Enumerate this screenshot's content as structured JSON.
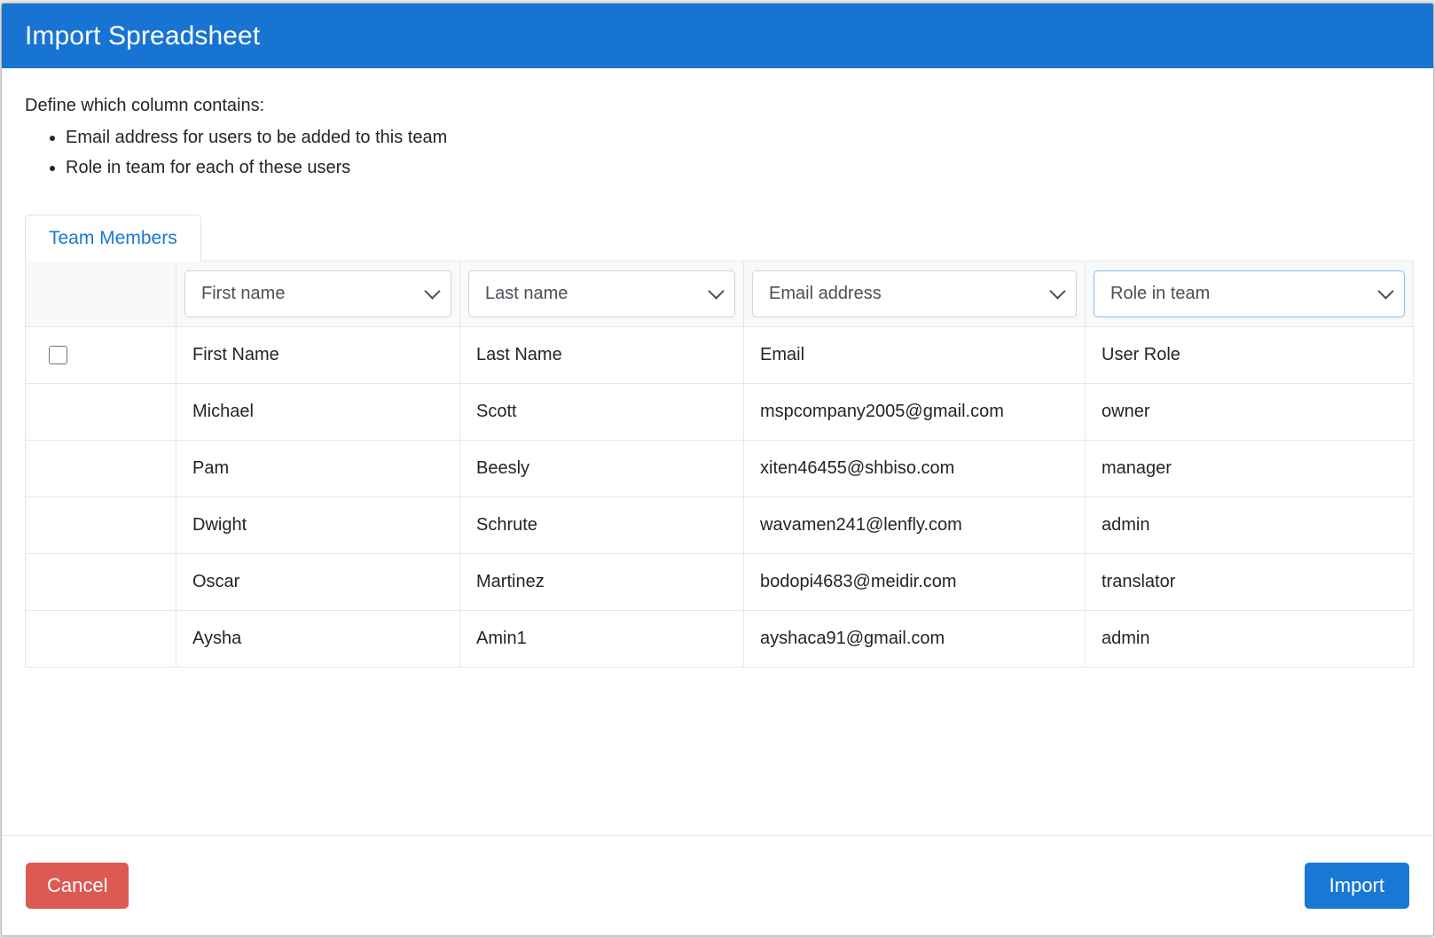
{
  "dialog": {
    "title": "Import Spreadsheet",
    "intro": "Define which column contains:",
    "bullets": [
      "Email address for users to be added to this team",
      "Role in team for each of these users"
    ]
  },
  "tabs": [
    {
      "label": "Team Members",
      "active": true
    }
  ],
  "mapping": {
    "columns": [
      {
        "name": "first-name-mapping",
        "value": "First name",
        "focused": false
      },
      {
        "name": "last-name-mapping",
        "value": "Last name",
        "focused": false
      },
      {
        "name": "email-mapping",
        "value": "Email address",
        "focused": false
      },
      {
        "name": "role-mapping",
        "value": "Role in team",
        "focused": true
      }
    ],
    "chevron_icon": "chevron-down-icon"
  },
  "table": {
    "header_row": {
      "checkbox_checked": false,
      "cells": [
        "First Name",
        "Last Name",
        "Email",
        "User Role"
      ]
    },
    "rows": [
      {
        "cells": [
          "Michael",
          "Scott",
          "mspcompany2005@gmail.com",
          "owner"
        ]
      },
      {
        "cells": [
          "Pam",
          "Beesly",
          "xiten46455@shbiso.com",
          "manager"
        ]
      },
      {
        "cells": [
          "Dwight",
          "Schrute",
          "wavamen241@lenfly.com",
          "admin"
        ]
      },
      {
        "cells": [
          "Oscar",
          "Martinez",
          "bodopi4683@meidir.com",
          "translator"
        ]
      },
      {
        "cells": [
          "Aysha",
          "Amin1",
          "ayshaca91@gmail.com",
          "admin"
        ]
      }
    ]
  },
  "footer": {
    "cancel_label": "Cancel",
    "import_label": "Import"
  },
  "colors": {
    "header_blue": "#1874d2",
    "accent_blue": "#1878d3",
    "cancel_red": "#dc5a51",
    "focus_border": "#80bdff",
    "row_header_bg": "#f8f9fa",
    "border_gray": "#e4e6e8"
  }
}
